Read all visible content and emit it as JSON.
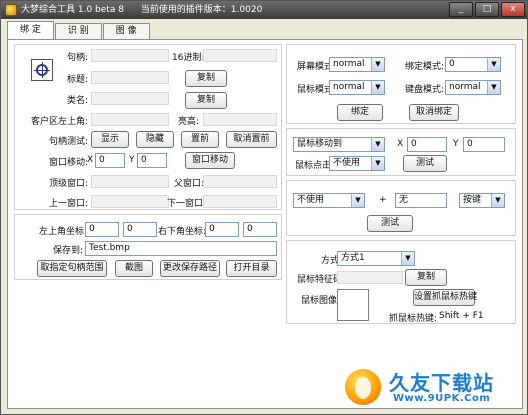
{
  "window": {
    "title": "大梦综合工具 1.0 beta 8",
    "version_text": "当前使用的插件版本：1.0020",
    "minimize": "_",
    "maximize": "□",
    "close": "x"
  },
  "tabs": [
    {
      "label": "绑 定",
      "active": true
    },
    {
      "label": "识 别",
      "active": false
    },
    {
      "label": "图 像",
      "active": false
    }
  ],
  "bind": {
    "handle_label": "句柄:",
    "hex_label": "16进制:",
    "title_label": "标题:",
    "class_label": "类名:",
    "copy1": "复制",
    "copy2": "复制",
    "client_topleft_label": "客户区左上角:",
    "height_label": "亮高:",
    "handle_test_label": "句柄测试:",
    "btn_show": "显示",
    "btn_hide": "隐藏",
    "btn_front": "置前",
    "btn_unfront": "取消置前",
    "move_label": "窗口移动:",
    "x_label": "X",
    "y_label": "Y",
    "move_x": "0",
    "move_y": "0",
    "btn_move": "窗口移动",
    "top_window_label": "顶级窗口:",
    "parent_window_label": "父窗口:",
    "prev_window_label": "上一窗口:",
    "next_window_label": "下一窗口:"
  },
  "coords": {
    "topleft_label": "左上角坐标:",
    "tl_x": "0",
    "tl_y": "0",
    "bottomright_label": "右下角坐标:",
    "br_x": "0",
    "br_y": "0",
    "save_label": "保存到:",
    "save_path": "Test.bmp",
    "btn_range": "取指定句柄范围",
    "btn_capture": "截图",
    "btn_change_path": "更改保存路径",
    "btn_open_dir": "打开目录"
  },
  "modes": {
    "screen_label": "屏幕模式:",
    "screen_value": "normal",
    "bind_label": "绑定模式:",
    "bind_value": "0",
    "mouse_label": "鼠标模式:",
    "mouse_value": "normal",
    "keyboard_label": "键盘模式:",
    "keyboard_value": "normal",
    "btn_bind": "绑定",
    "btn_unbind": "取消绑定"
  },
  "mouse": {
    "action_value": "鼠标移动到",
    "x_label": "X",
    "x_value": "0",
    "y_label": "Y",
    "y_value": "0",
    "click_label": "鼠标点击:",
    "click_value": "不使用",
    "btn_test": "测试"
  },
  "keys": {
    "modifier_value": "不使用",
    "plus": "+",
    "key_value": "无",
    "action_value": "按键",
    "btn_test": "测试"
  },
  "capture": {
    "mode_label": "方式:",
    "mode_value": "方式1",
    "feature_label": "鼠标特征码:",
    "btn_copy": "复制",
    "image_label": "鼠标图像:",
    "btn_hotkey": "设置抓鼠标热键",
    "hotkey_label": "抓鼠标热键:",
    "hotkey_value": "Shift + F1"
  },
  "watermark": {
    "title": "久友下载站",
    "url": "Www.9UPK.Com"
  }
}
